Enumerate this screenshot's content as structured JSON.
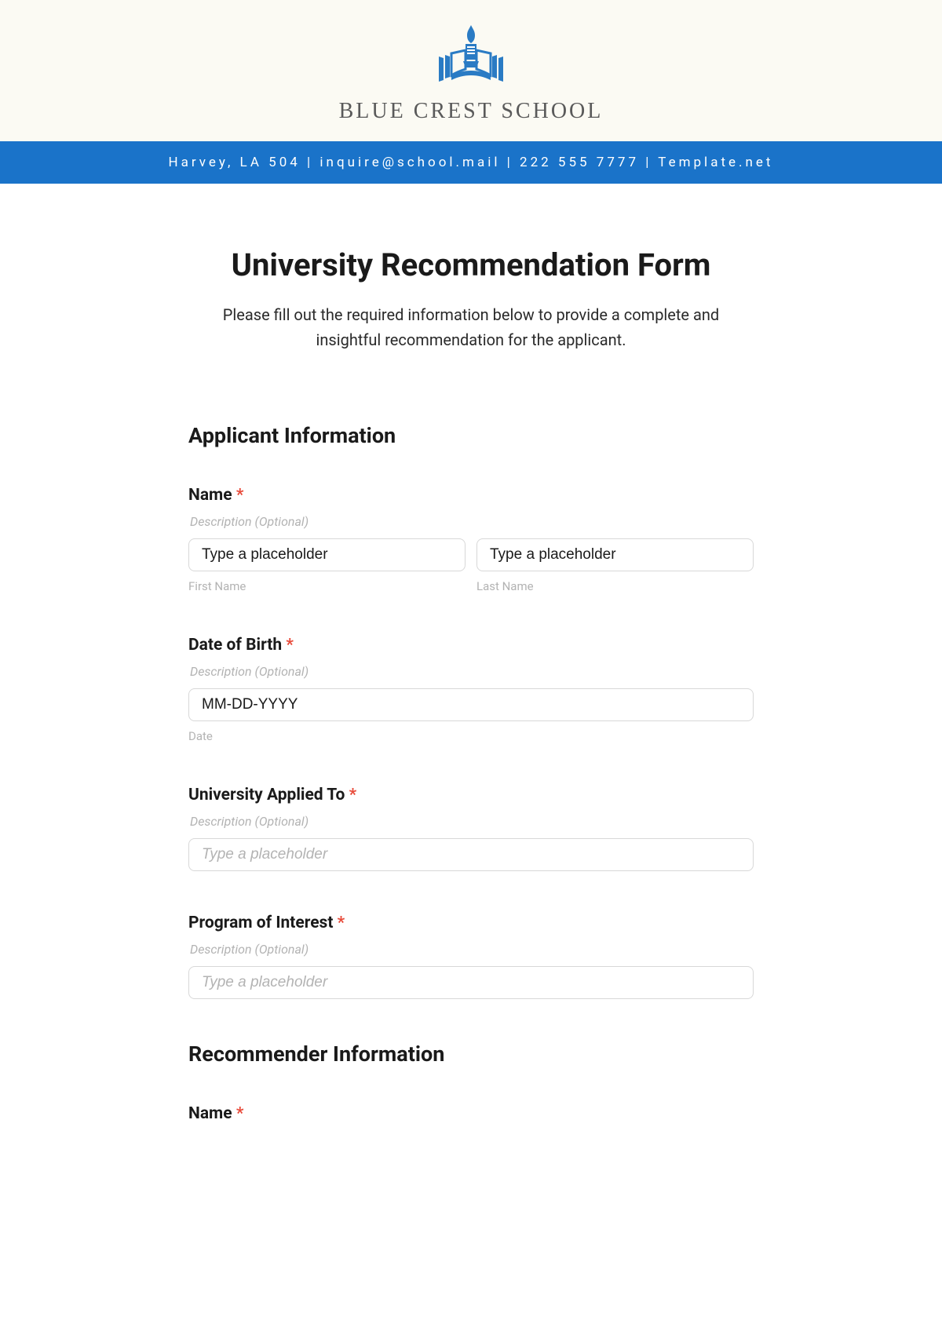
{
  "header": {
    "school_name": "BLUE CREST SCHOOL",
    "contact_line": "Harvey, LA 504 | inquire@school.mail | 222 555 7777 | Template.net"
  },
  "form": {
    "title": "University Recommendation Form",
    "intro": "Please fill out the required information below to provide a complete and insightful recommendation for the applicant."
  },
  "sections": {
    "applicant": {
      "heading": "Applicant Information",
      "name": {
        "label": "Name",
        "description": "Description (Optional)",
        "first_placeholder": "Type a placeholder",
        "first_sublabel": "First Name",
        "last_placeholder": "Type a placeholder",
        "last_sublabel": "Last Name"
      },
      "dob": {
        "label": "Date of Birth",
        "description": "Description (Optional)",
        "placeholder": "MM-DD-YYYY",
        "sublabel": "Date"
      },
      "university": {
        "label": "University Applied To",
        "description": "Description (Optional)",
        "placeholder": "Type a placeholder"
      },
      "program": {
        "label": "Program of Interest",
        "description": "Description (Optional)",
        "placeholder": "Type a placeholder"
      }
    },
    "recommender": {
      "heading": "Recommender Information",
      "name": {
        "label": "Name"
      }
    }
  },
  "required_marker": "*"
}
